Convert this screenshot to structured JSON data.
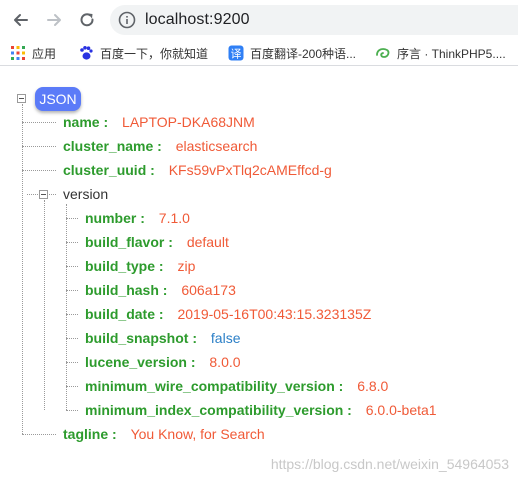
{
  "browser": {
    "url": "localhost:9200"
  },
  "bookmarks": [
    {
      "label": "应用",
      "icon": "apps-grid-icon"
    },
    {
      "label": "百度一下，你就知道",
      "icon": "baidu-paw-icon"
    },
    {
      "label": "百度翻译-200种语...",
      "icon": "translate-icon"
    },
    {
      "label": "序言 · ThinkPHP5....",
      "icon": "thinkphp-icon"
    }
  ],
  "json": {
    "root_label": "JSON",
    "fields": [
      {
        "key": "name",
        "value": "LAPTOP-DKA68JNM"
      },
      {
        "key": "cluster_name",
        "value": "elasticsearch"
      },
      {
        "key": "cluster_uuid",
        "value": "KFs59vPxTlq2cAMEffcd-g"
      }
    ],
    "version_key": "version",
    "version_fields": [
      {
        "key": "number",
        "value": "7.1.0"
      },
      {
        "key": "build_flavor",
        "value": "default"
      },
      {
        "key": "build_type",
        "value": "zip"
      },
      {
        "key": "build_hash",
        "value": "606a173"
      },
      {
        "key": "build_date",
        "value": "2019-05-16T00:43:15.323135Z"
      },
      {
        "key": "build_snapshot",
        "value": "false"
      },
      {
        "key": "lucene_version",
        "value": "8.0.0"
      },
      {
        "key": "minimum_wire_compatibility_version",
        "value": "6.8.0"
      },
      {
        "key": "minimum_index_compatibility_version",
        "value": "6.0.0-beta1"
      }
    ],
    "tagline": {
      "key": "tagline",
      "value": "You Know, for Search"
    },
    "separator": " : "
  },
  "watermark": "https://blog.csdn.net/weixin_54964053",
  "colors": {
    "key": "#2d9b2d",
    "string": "#f05a37",
    "boolean": "#2b7fc7",
    "root_badge": "#5b7bf8"
  }
}
